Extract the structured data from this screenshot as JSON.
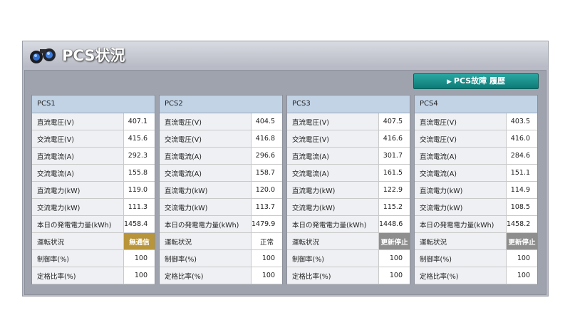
{
  "header": {
    "title": "PCS状況"
  },
  "history_button": {
    "label": "PCS故障 履歴"
  },
  "panels": [
    {
      "name": "PCS1",
      "rows": [
        {
          "label": "直流電圧(V)",
          "value": "407.1"
        },
        {
          "label": "交流電圧(V)",
          "value": "415.6"
        },
        {
          "label": "直流電流(A)",
          "value": "292.3"
        },
        {
          "label": "交流電流(A)",
          "value": "155.8"
        },
        {
          "label": "直流電力(kW)",
          "value": "119.0"
        },
        {
          "label": "交流電力(kW)",
          "value": "111.3"
        },
        {
          "label": "本日の発電電力量(kWh)",
          "value": "1458.4"
        },
        {
          "label": "運転状況",
          "value": "無通信"
        },
        {
          "label": "制御率(%)",
          "value": "100"
        },
        {
          "label": "定格比率(%)",
          "value": "100"
        }
      ]
    },
    {
      "name": "PCS2",
      "rows": [
        {
          "label": "直流電圧(V)",
          "value": "404.5"
        },
        {
          "label": "交流電圧(V)",
          "value": "416.8"
        },
        {
          "label": "直流電流(A)",
          "value": "296.6"
        },
        {
          "label": "交流電流(A)",
          "value": "158.7"
        },
        {
          "label": "直流電力(kW)",
          "value": "120.0"
        },
        {
          "label": "交流電力(kW)",
          "value": "113.7"
        },
        {
          "label": "本日の発電電力量(kWh)",
          "value": "1479.9"
        },
        {
          "label": "運転状況",
          "value": "正常"
        },
        {
          "label": "制御率(%)",
          "value": "100"
        },
        {
          "label": "定格比率(%)",
          "value": "100"
        }
      ]
    },
    {
      "name": "PCS3",
      "rows": [
        {
          "label": "直流電圧(V)",
          "value": "407.5"
        },
        {
          "label": "交流電圧(V)",
          "value": "416.6"
        },
        {
          "label": "直流電流(A)",
          "value": "301.7"
        },
        {
          "label": "交流電流(A)",
          "value": "161.5"
        },
        {
          "label": "直流電力(kW)",
          "value": "122.9"
        },
        {
          "label": "交流電力(kW)",
          "value": "115.2"
        },
        {
          "label": "本日の発電電力量(kWh)",
          "value": "1448.6"
        },
        {
          "label": "運転状況",
          "value": "更新停止"
        },
        {
          "label": "制御率(%)",
          "value": "100"
        },
        {
          "label": "定格比率(%)",
          "value": "100"
        }
      ]
    },
    {
      "name": "PCS4",
      "rows": [
        {
          "label": "直流電圧(V)",
          "value": "403.5"
        },
        {
          "label": "交流電圧(V)",
          "value": "416.0"
        },
        {
          "label": "直流電流(A)",
          "value": "284.6"
        },
        {
          "label": "交流電流(A)",
          "value": "151.1"
        },
        {
          "label": "直流電力(kW)",
          "value": "114.9"
        },
        {
          "label": "交流電力(kW)",
          "value": "108.5"
        },
        {
          "label": "本日の発電電力量(kWh)",
          "value": "1458.2"
        },
        {
          "label": "運転状況",
          "value": "更新停止"
        },
        {
          "label": "制御率(%)",
          "value": "100"
        },
        {
          "label": "定格比率(%)",
          "value": "100"
        }
      ]
    }
  ],
  "colors": {
    "status_no_comm": "#b8953a",
    "status_stopped": "#8e8e8e",
    "button": "#0d7a76",
    "panel_header": "#c2d3e6"
  },
  "icons": {
    "title_icon": "binoculars-icon",
    "button_icon": "triangle-right-icon"
  }
}
